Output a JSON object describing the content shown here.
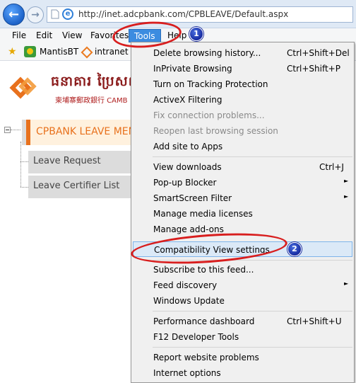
{
  "browser": {
    "url": "http://inet.adcpbank.com/CPBLEAVE/Default.aspx",
    "back_glyph": "←",
    "forward_glyph": "→",
    "ie_glyph": "e",
    "back_icon": "back-arrow-icon",
    "forward_icon": "forward-arrow-icon"
  },
  "menubar": {
    "file": "File",
    "edit": "Edit",
    "view": "View",
    "favorites": "Favorites",
    "tools": "Tools",
    "help": "Help",
    "tools_highlight_color": "#3c8ce0"
  },
  "favorites_bar": {
    "star_glyph": "★",
    "items": [
      {
        "label": "MantisBT",
        "icon": "mantis-icon"
      },
      {
        "label": "intranet t",
        "icon": "intranet-icon"
      }
    ]
  },
  "page": {
    "logo_khmer": "ធនាគារ ប្រៃសណីយ",
    "logo_cjk": "柬埔寨郵政銀行 CAMB",
    "side_menu_title": "CPBANK LEAVE MENU",
    "side_links": [
      "Leave Request",
      "Leave Certifier List"
    ],
    "accent_color": "#e8711d"
  },
  "tools_menu": {
    "items": [
      {
        "label": "Delete browsing history...",
        "shortcut": "Ctrl+Shift+Del"
      },
      {
        "label": "InPrivate Browsing",
        "shortcut": "Ctrl+Shift+P"
      },
      {
        "label": "Turn on Tracking Protection"
      },
      {
        "label": "ActiveX Filtering"
      },
      {
        "label": "Fix connection problems...",
        "disabled": true
      },
      {
        "label": "Reopen last browsing session",
        "disabled": true
      },
      {
        "label": "Add site to Apps"
      },
      {
        "label": "View downloads",
        "shortcut": "Ctrl+J"
      },
      {
        "label": "Pop-up Blocker",
        "submenu": true
      },
      {
        "label": "SmartScreen Filter",
        "submenu": true
      },
      {
        "label": "Manage media licenses"
      },
      {
        "label": "Manage add-ons"
      },
      {
        "label": "Compatibility View settings",
        "highlighted": true
      },
      {
        "label": "Subscribe to this feed..."
      },
      {
        "label": "Feed discovery",
        "submenu": true
      },
      {
        "label": "Windows Update"
      },
      {
        "label": "Performance dashboard",
        "shortcut": "Ctrl+Shift+U"
      },
      {
        "label": "F12 Developer Tools"
      },
      {
        "label": "Report website problems"
      },
      {
        "label": "Internet options"
      }
    ],
    "submenu_glyph": "►"
  },
  "annotations": {
    "step1": "1",
    "step2": "2",
    "callout_color": "#d81e1e"
  }
}
